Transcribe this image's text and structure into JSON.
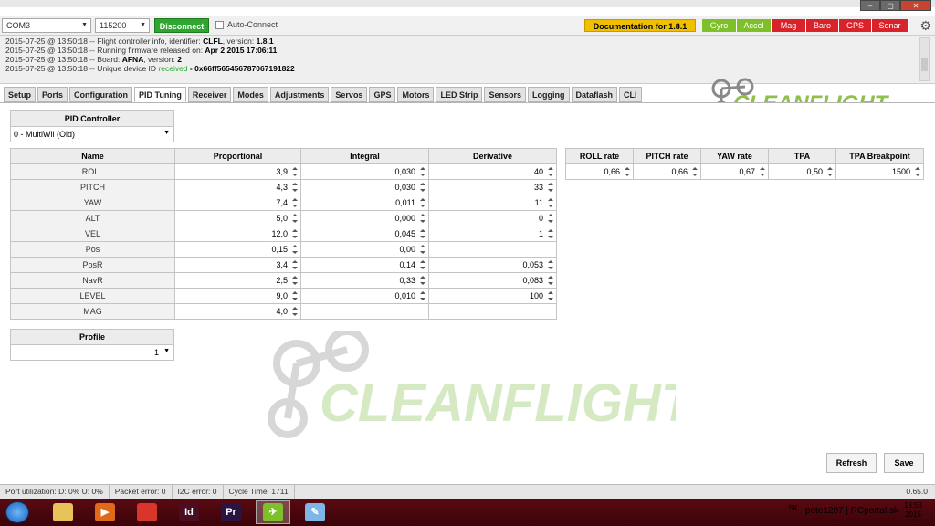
{
  "window": {
    "controls": [
      "–",
      "▢",
      "✕"
    ]
  },
  "topbar": {
    "port": "COM3",
    "baud": "115200",
    "disconnect_label": "Disconnect",
    "auto_connect_label": "Auto-Connect",
    "doc_label": "Documentation for 1.8.1",
    "sensors": [
      {
        "label": "Gyro",
        "color": "#7ec02a"
      },
      {
        "label": "Accel",
        "color": "#7ec02a"
      },
      {
        "label": "Mag",
        "color": "#d8232a"
      },
      {
        "label": "Baro",
        "color": "#d8232a"
      },
      {
        "label": "GPS",
        "color": "#d8232a"
      },
      {
        "label": "Sonar",
        "color": "#d8232a"
      }
    ]
  },
  "log": [
    {
      "prefix": "2015-07-25 @ 13:50:18 -- Flight controller info, identifier: ",
      "b1": "CLFL",
      "mid": ", version: ",
      "b2": "1.8.1",
      "ok": "",
      "tail": ""
    },
    {
      "prefix": "2015-07-25 @ 13:50:18 -- Running firmware released on: ",
      "b1": "Apr 2 2015 17:06:11",
      "mid": "",
      "b2": "",
      "ok": "",
      "tail": ""
    },
    {
      "prefix": "2015-07-25 @ 13:50:18 -- Board: ",
      "b1": "AFNA",
      "mid": ", version: ",
      "b2": "2",
      "ok": "",
      "tail": ""
    },
    {
      "prefix": "2015-07-25 @ 13:50:18 -- Unique device ID ",
      "b1": "",
      "mid": "",
      "b2": "",
      "ok": "received",
      "tail": " - 0x66ff565456787067191822"
    }
  ],
  "logo_text": "CLEANFLIGHT",
  "tabs": [
    "Setup",
    "Ports",
    "Configuration",
    "PID Tuning",
    "Receiver",
    "Modes",
    "Adjustments",
    "Servos",
    "GPS",
    "Motors",
    "LED Strip",
    "Sensors",
    "Logging",
    "Dataflash",
    "CLI"
  ],
  "active_tab": "PID Tuning",
  "pid_controller": {
    "header": "PID Controller",
    "value": "0 - MultiWii (Old)"
  },
  "pid_table": {
    "headers": [
      "Name",
      "Proportional",
      "Integral",
      "Derivative"
    ],
    "rows": [
      {
        "name": "ROLL",
        "p": "3,9",
        "i": "0,030",
        "d": "40"
      },
      {
        "name": "PITCH",
        "p": "4,3",
        "i": "0,030",
        "d": "33"
      },
      {
        "name": "YAW",
        "p": "7,4",
        "i": "0,011",
        "d": "11"
      },
      {
        "name": "ALT",
        "p": "5,0",
        "i": "0,000",
        "d": "0"
      },
      {
        "name": "VEL",
        "p": "12,0",
        "i": "0,045",
        "d": "1"
      },
      {
        "name": "Pos",
        "p": "0,15",
        "i": "0,00",
        "d": ""
      },
      {
        "name": "PosR",
        "p": "3,4",
        "i": "0,14",
        "d": "0,053"
      },
      {
        "name": "NavR",
        "p": "2,5",
        "i": "0,33",
        "d": "0,083"
      },
      {
        "name": "LEVEL",
        "p": "9,0",
        "i": "0,010",
        "d": "100"
      },
      {
        "name": "MAG",
        "p": "4,0",
        "i": "",
        "d": ""
      }
    ]
  },
  "rate_table": {
    "headers": [
      "ROLL rate",
      "PITCH rate",
      "YAW rate",
      "TPA",
      "TPA Breakpoint"
    ],
    "values": [
      "0,66",
      "0,66",
      "0,67",
      "0,50",
      "1500"
    ]
  },
  "profile": {
    "header": "Profile",
    "value": "1"
  },
  "buttons": {
    "refresh": "Refresh",
    "save": "Save"
  },
  "status": {
    "port_util": "Port utilization: D: 0% U: 0%",
    "packet_error": "Packet error: 0",
    "i2c_error": "I2C error: 0",
    "cycle_time": "Cycle Time: 1711",
    "version": "0.65.0"
  },
  "taskbar": {
    "apps": [
      {
        "name": "explorer-icon",
        "glyph": "",
        "color": "#e8c35a"
      },
      {
        "name": "media-player-icon",
        "glyph": "▶",
        "color": "#e06a1a"
      },
      {
        "name": "chrome-icon",
        "glyph": "",
        "color": "#d9362b"
      },
      {
        "name": "indesign-icon",
        "glyph": "Id",
        "color": "#4a0d22"
      },
      {
        "name": "premiere-icon",
        "glyph": "Pr",
        "color": "#2a1442"
      },
      {
        "name": "cleanflight-icon",
        "glyph": "✈",
        "color": "#7ec02a"
      },
      {
        "name": "paint-icon",
        "glyph": "✎",
        "color": "#7fb6e8"
      }
    ],
    "lang": "SK",
    "user": "pete1207 | RCportal.sk",
    "time": "13:53",
    "year": "2015"
  }
}
